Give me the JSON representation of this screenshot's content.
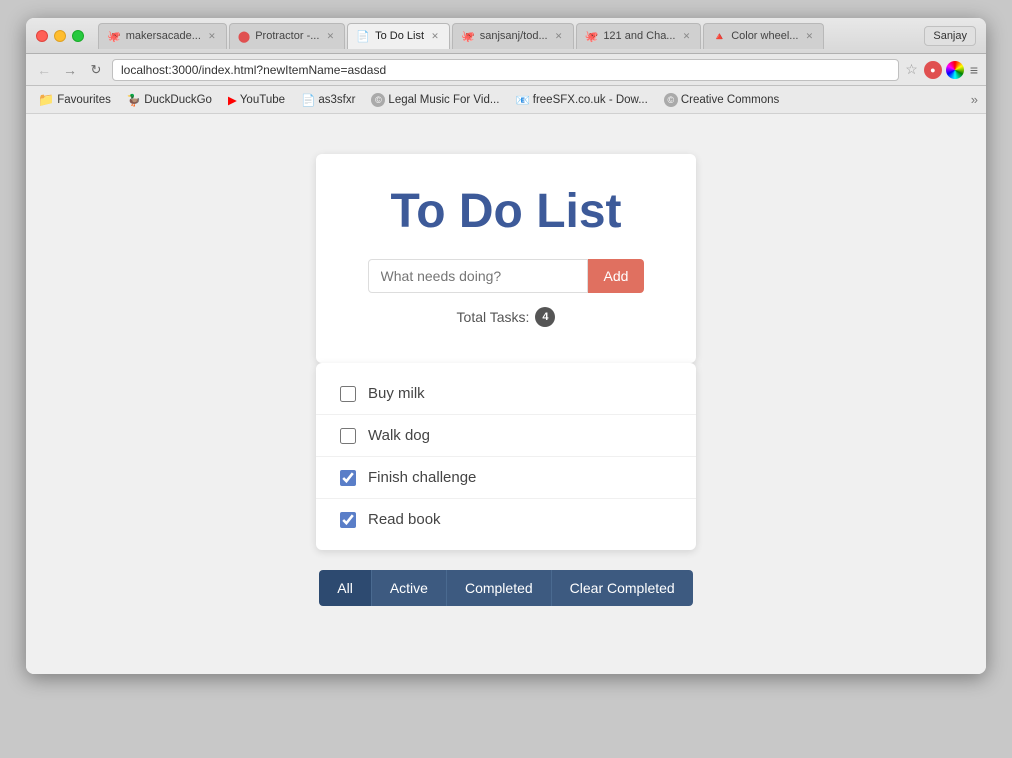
{
  "browser": {
    "tabs": [
      {
        "id": "tab1",
        "label": "makersacade...",
        "icon": "🐙",
        "active": false,
        "closeable": true
      },
      {
        "id": "tab2",
        "label": "Protractor -...",
        "icon": "⭕",
        "active": false,
        "closeable": true
      },
      {
        "id": "tab3",
        "label": "To Do List",
        "icon": "📄",
        "active": true,
        "closeable": true
      },
      {
        "id": "tab4",
        "label": "sanjsanj/tod...",
        "icon": "🐙",
        "active": false,
        "closeable": true
      },
      {
        "id": "tab5",
        "label": "121 and Cha...",
        "icon": "🐙",
        "active": false,
        "closeable": true
      },
      {
        "id": "tab6",
        "label": "Color wheel...",
        "icon": "🔺",
        "active": false,
        "closeable": true
      }
    ],
    "profile": "Sanjay",
    "url": "localhost:3000/index.html?newItemName=asdasd",
    "bookmarks": [
      {
        "id": "bm1",
        "label": "Favourites",
        "icon": "📁"
      },
      {
        "id": "bm2",
        "label": "DuckDuckGo",
        "icon": "🦆"
      },
      {
        "id": "bm3",
        "label": "YouTube",
        "icon": "▶"
      },
      {
        "id": "bm4",
        "label": "as3sfxr",
        "icon": "📄"
      },
      {
        "id": "bm5",
        "label": "Legal Music For Vid...",
        "icon": "©"
      },
      {
        "id": "bm6",
        "label": "freeSFX.co.uk - Dow...",
        "icon": "📧"
      },
      {
        "id": "bm7",
        "label": "Creative Commons",
        "icon": "©"
      }
    ]
  },
  "app": {
    "title": "To Do List",
    "input_placeholder": "What needs doing?",
    "add_button_label": "Add",
    "total_tasks_label": "Total Tasks:",
    "total_tasks_count": "4",
    "tasks": [
      {
        "id": 1,
        "label": "Buy milk",
        "completed": false
      },
      {
        "id": 2,
        "label": "Walk dog",
        "completed": false
      },
      {
        "id": 3,
        "label": "Finish challenge",
        "completed": true
      },
      {
        "id": 4,
        "label": "Read book",
        "completed": true
      }
    ],
    "filters": [
      {
        "id": "all",
        "label": "All",
        "active": true
      },
      {
        "id": "active",
        "label": "Active",
        "active": false
      },
      {
        "id": "completed",
        "label": "Completed",
        "active": false
      },
      {
        "id": "clear",
        "label": "Clear Completed",
        "active": false
      }
    ]
  }
}
